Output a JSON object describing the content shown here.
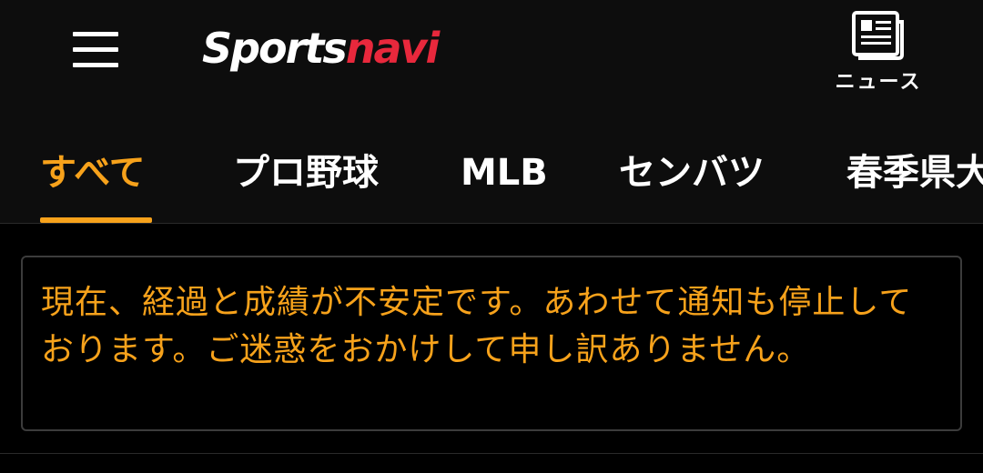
{
  "header": {
    "logo_part_a": "Sports",
    "logo_part_b": "navi",
    "news_label": "ニュース"
  },
  "tabs": [
    {
      "label": "すべて",
      "active": true
    },
    {
      "label": "プロ野球",
      "active": false
    },
    {
      "label": "MLB",
      "active": false
    },
    {
      "label": "センバツ",
      "active": false
    },
    {
      "label": "春季県大",
      "active": false
    }
  ],
  "notice": {
    "text": "現在、経過と成績が不安定です。あわせて通知も停止しております。ご迷惑をおかけして申し訳ありません。"
  },
  "colors": {
    "accent": "#f7a21b",
    "logo_red": "#e8283c",
    "header_bg": "#0d0d0d",
    "page_bg": "#000000"
  },
  "icons": {
    "menu": "hamburger-menu-icon",
    "news": "newspaper-icon"
  }
}
